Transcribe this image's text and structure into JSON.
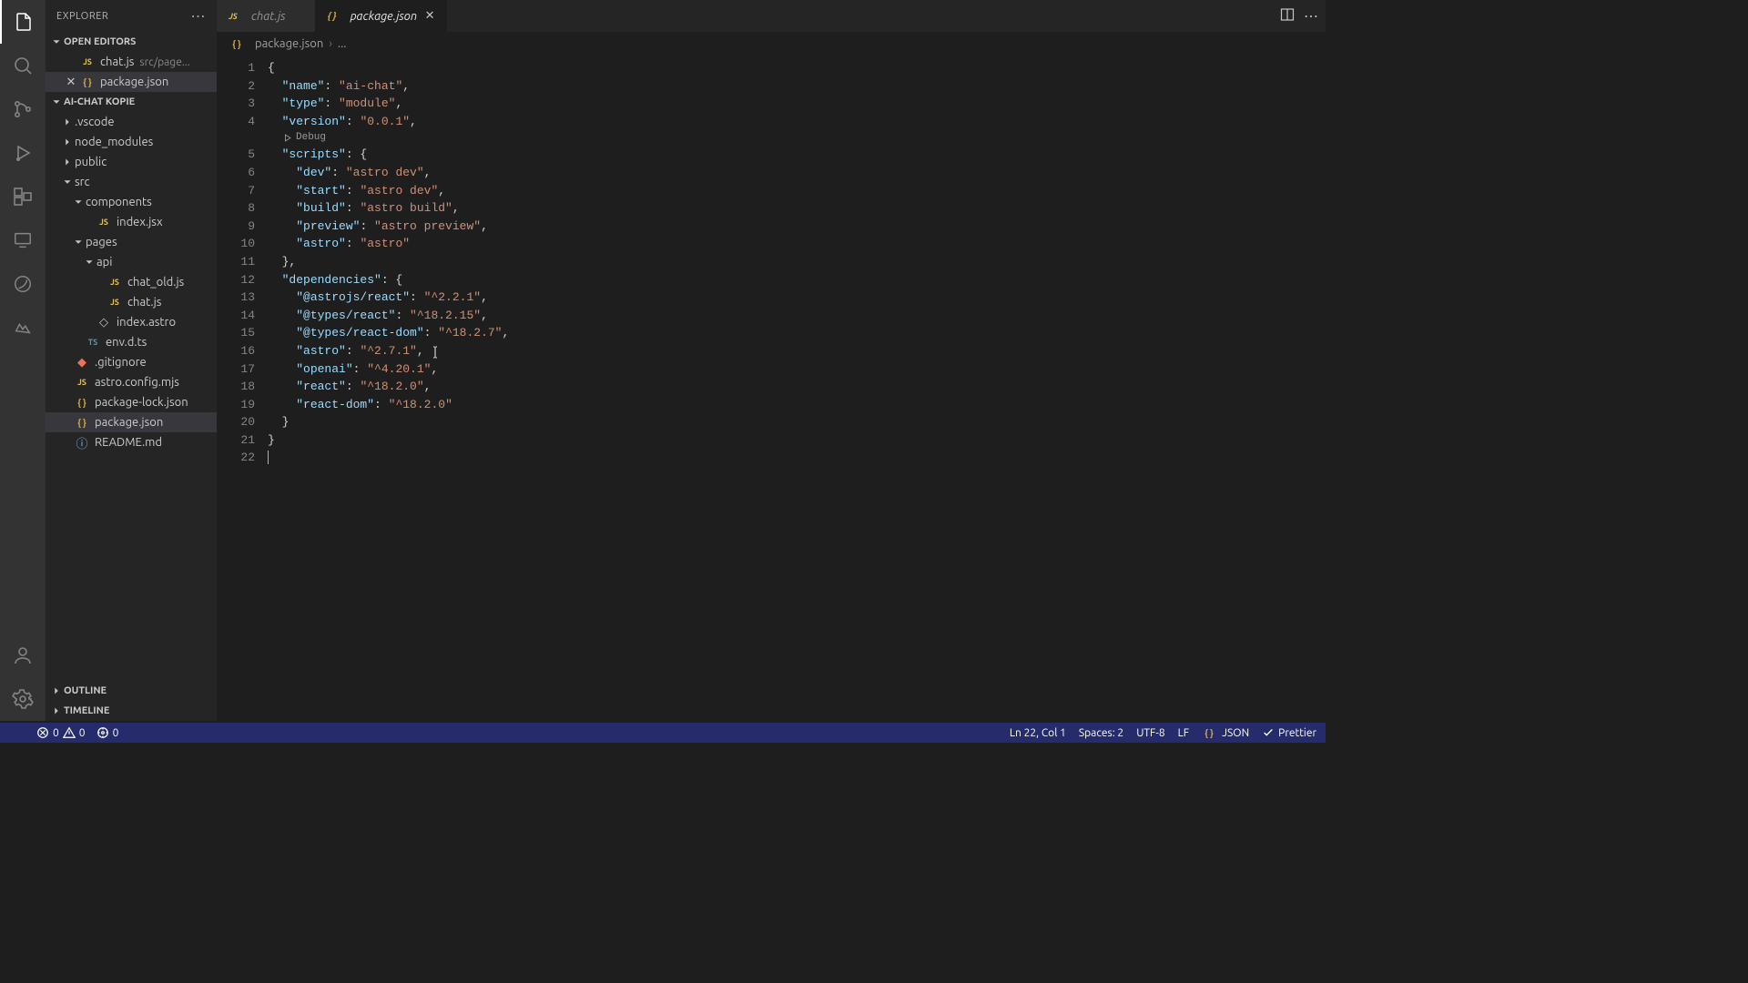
{
  "sidebar": {
    "title": "EXPLORER",
    "openEditors": {
      "title": "OPEN EDITORS",
      "items": [
        {
          "icon": "js",
          "label": "chat.js",
          "hint": "src/page..."
        },
        {
          "icon": "json",
          "label": "package.json",
          "hint": ""
        }
      ]
    },
    "project": {
      "title": "AI-CHAT KOPIE",
      "tree": [
        {
          "depth": 0,
          "open": false,
          "kind": "folder",
          "label": ".vscode"
        },
        {
          "depth": 0,
          "open": false,
          "kind": "folder",
          "label": "node_modules"
        },
        {
          "depth": 0,
          "open": false,
          "kind": "folder",
          "label": "public"
        },
        {
          "depth": 0,
          "open": true,
          "kind": "folder",
          "label": "src"
        },
        {
          "depth": 1,
          "open": true,
          "kind": "folder",
          "label": "components"
        },
        {
          "depth": 2,
          "open": false,
          "kind": "file",
          "icon": "js",
          "label": "index.jsx"
        },
        {
          "depth": 1,
          "open": true,
          "kind": "folder",
          "label": "pages"
        },
        {
          "depth": 2,
          "open": true,
          "kind": "folder",
          "label": "api"
        },
        {
          "depth": 3,
          "open": false,
          "kind": "file",
          "icon": "js",
          "label": "chat_old.js"
        },
        {
          "depth": 3,
          "open": false,
          "kind": "file",
          "icon": "js",
          "label": "chat.js"
        },
        {
          "depth": 2,
          "open": false,
          "kind": "file",
          "icon": "astro",
          "label": "index.astro"
        },
        {
          "depth": 1,
          "open": false,
          "kind": "file",
          "icon": "ts",
          "label": "env.d.ts"
        },
        {
          "depth": 0,
          "open": false,
          "kind": "file",
          "icon": "git",
          "label": ".gitignore"
        },
        {
          "depth": 0,
          "open": false,
          "kind": "file",
          "icon": "js",
          "label": "astro.config.mjs"
        },
        {
          "depth": 0,
          "open": false,
          "kind": "file",
          "icon": "json",
          "label": "package-lock.json"
        },
        {
          "depth": 0,
          "open": false,
          "kind": "file",
          "icon": "json",
          "label": "package.json",
          "selected": true
        },
        {
          "depth": 0,
          "open": false,
          "kind": "file",
          "icon": "info",
          "label": "README.md"
        }
      ]
    },
    "outline": "OUTLINE",
    "timeline": "TIMELINE"
  },
  "tabs": [
    {
      "icon": "js",
      "label": "chat.js",
      "active": false
    },
    {
      "icon": "json",
      "label": "package.json",
      "active": true
    }
  ],
  "breadcrumb": {
    "file": "package.json",
    "more": "..."
  },
  "codelens": "Debug",
  "file": {
    "name": "ai-chat",
    "type": "module",
    "version": "0.0.1",
    "scripts": {
      "dev": "astro dev",
      "start": "astro dev",
      "build": "astro build",
      "preview": "astro preview",
      "astro": "astro"
    },
    "dependencies": {
      "@astrojs/react": "^2.2.1",
      "@types/react": "^18.2.15",
      "@types/react-dom": "^18.2.7",
      "astro": "^2.7.1",
      "openai": "^4.20.1",
      "react": "^18.2.0",
      "react-dom": "^18.2.0"
    }
  },
  "status": {
    "errors": "0",
    "warnings": "0",
    "port": "0",
    "pos": "Ln 22, Col 1",
    "spaces": "Spaces: 2",
    "enc": "UTF-8",
    "eol": "LF",
    "lang": "JSON",
    "prettier": "Prettier"
  }
}
